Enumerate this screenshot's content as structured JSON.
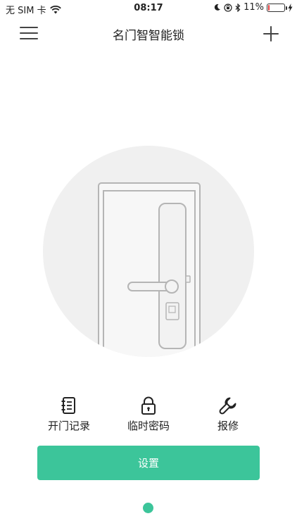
{
  "status_bar": {
    "carrier": "无 SIM 卡",
    "time": "08:17",
    "battery_text": "11%",
    "battery_level": 0.11,
    "icons": [
      "wifi-icon",
      "moon-icon",
      "rotation-lock-icon",
      "bluetooth-icon",
      "battery-icon",
      "charging-icon"
    ]
  },
  "nav": {
    "title": "名门智智能锁",
    "menu_icon": "hamburger-menu-icon",
    "add_icon": "plus-icon"
  },
  "illustration": {
    "icon": "door-with-smart-lock-icon"
  },
  "actions": [
    {
      "label": "开门记录",
      "icon": "notebook-icon"
    },
    {
      "label": "临时密码",
      "icon": "padlock-icon"
    },
    {
      "label": "报修",
      "icon": "wrench-icon"
    }
  ],
  "settings_button": {
    "label": "设置"
  },
  "pager": {
    "total": 1,
    "active": 1
  },
  "colors": {
    "accent": "#3cc59a",
    "circle_bg": "#f0f0f0",
    "battery_low": "#e33b3b"
  }
}
